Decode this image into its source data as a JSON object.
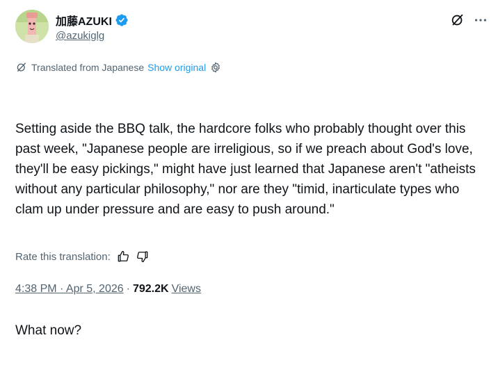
{
  "author": {
    "display_name": "加藤AZUKI",
    "handle": "@azukiglg",
    "verified": true
  },
  "icons": {
    "grok": "grok-icon",
    "more": "more-options-icon",
    "translate": "translate-icon",
    "settings": "settings-icon",
    "thumb_up": "thumbs-up-icon",
    "thumb_down": "thumbs-down-icon",
    "verified": "verified-badge-icon"
  },
  "translation": {
    "label": "Translated from Japanese",
    "show_original": "Show original"
  },
  "tweet": {
    "paragraph_1": "Setting aside the BBQ talk, the hardcore folks who probably thought over this past week, \"Japanese people are irreligious, so if we preach about God's love, they'll be easy pickings,\" might have just learned that Japanese aren't \"atheists without any particular philosophy,\" nor are they \"timid, inarticulate types who clam up under pressure and are easy to push around.\"",
    "paragraph_2": "What now?"
  },
  "rate": {
    "label": "Rate this translation:"
  },
  "meta": {
    "time_date": "4:38 PM · Apr 5, 2026",
    "separator": "·",
    "views_count": "792.2K",
    "views_label": "Views"
  },
  "colors": {
    "text_primary": "#0f1419",
    "text_secondary": "#536471",
    "accent_blue": "#1d9bf0",
    "verified_blue": "#1d9bf0"
  }
}
